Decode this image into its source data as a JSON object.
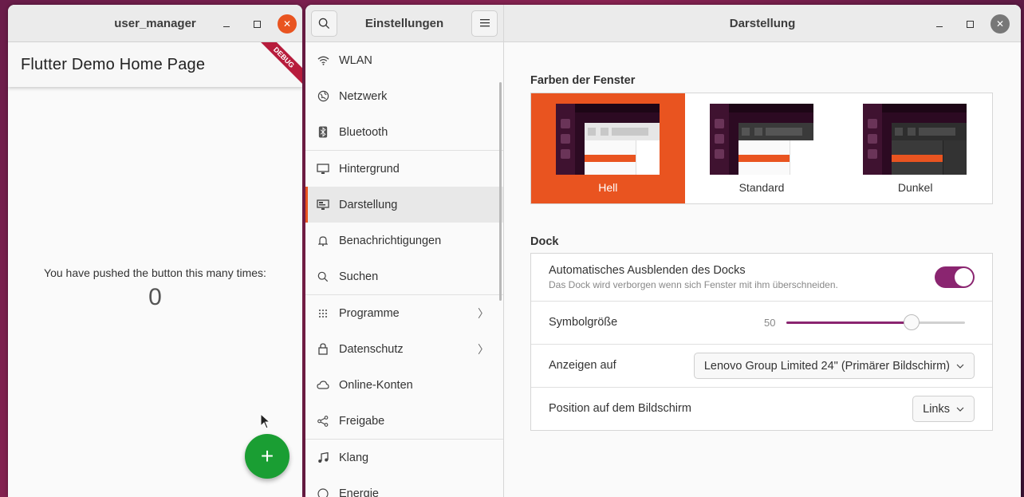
{
  "flutter_window": {
    "title": "user_manager",
    "appbar_title": "Flutter Demo Home Page",
    "debug_banner": "DEBUG",
    "counter_text": "You have pushed the button this many times:",
    "counter_value": "0",
    "fab_label": "+"
  },
  "settings_window": {
    "sidebar_title": "Einstellungen",
    "page_title": "Darstellung",
    "sidebar": {
      "items": [
        {
          "label": "WLAN",
          "icon": "wifi-icon"
        },
        {
          "label": "Netzwerk",
          "icon": "globe-icon"
        },
        {
          "label": "Bluetooth",
          "icon": "bluetooth-icon"
        },
        {
          "label": "Hintergrund",
          "icon": "monitor-icon"
        },
        {
          "label": "Darstellung",
          "icon": "appearance-icon"
        },
        {
          "label": "Benachrichtigungen",
          "icon": "bell-icon"
        },
        {
          "label": "Suchen",
          "icon": "search-icon"
        },
        {
          "label": "Programme",
          "icon": "grid-icon"
        },
        {
          "label": "Datenschutz",
          "icon": "lock-icon"
        },
        {
          "label": "Online-Konten",
          "icon": "cloud-icon"
        },
        {
          "label": "Freigabe",
          "icon": "share-icon"
        },
        {
          "label": "Klang",
          "icon": "music-icon"
        },
        {
          "label": "Energie",
          "icon": "power-icon"
        }
      ]
    },
    "window_colors": {
      "heading": "Farben der Fenster",
      "options": [
        "Hell",
        "Standard",
        "Dunkel"
      ],
      "selected": "Hell"
    },
    "dock": {
      "heading": "Dock",
      "autohide_label": "Automatisches Ausblenden des Docks",
      "autohide_sub": "Das Dock wird verborgen wenn sich Fenster mit ihm überschneiden.",
      "autohide_on": true,
      "icon_size_label": "Symbolgröße",
      "icon_size_value": "50",
      "icon_size_fraction": 0.7,
      "show_on_label": "Anzeigen auf",
      "show_on_value": "Lenovo Group Limited 24\" (Primärer Bildschirm)",
      "position_label": "Position auf dem Bildschirm",
      "position_value": "Links"
    }
  },
  "colors": {
    "accent": "#e95420",
    "toggle": "#8a2570",
    "fab": "#1a9e33"
  }
}
